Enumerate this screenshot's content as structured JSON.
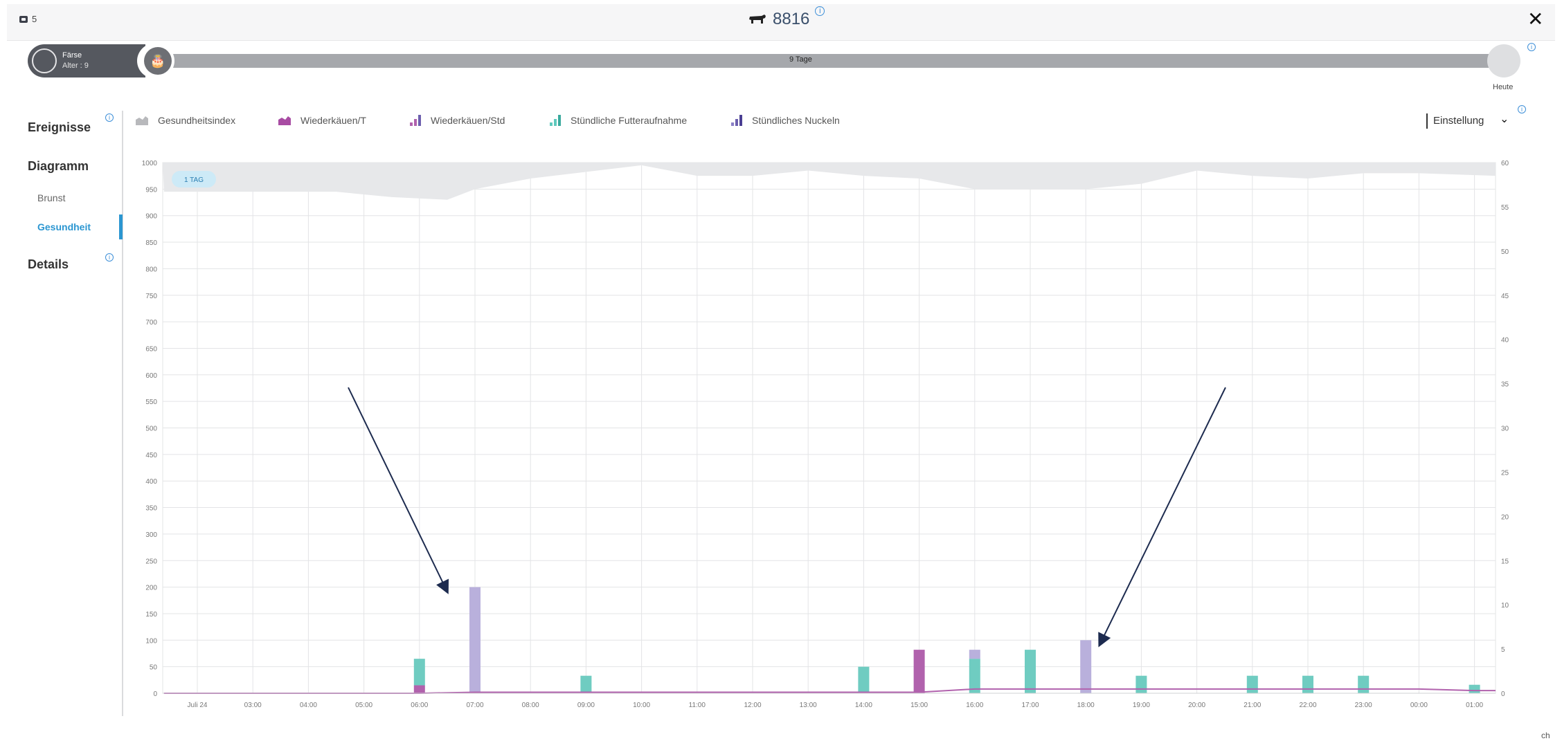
{
  "header": {
    "group_count": "5",
    "animal_id": "8816",
    "close_label": "✕",
    "info_glyph": "i"
  },
  "timeline": {
    "stage_label": "Färse",
    "age_label": "Alter : 9",
    "span_label": "9 Tage",
    "today_label": "Heute",
    "cake_glyph": "🎂"
  },
  "sidebar": {
    "ereignisse": "Ereignisse",
    "diagramm": "Diagramm",
    "brunst": "Brunst",
    "gesundheit": "Gesundheit",
    "details": "Details"
  },
  "legend": {
    "items": [
      {
        "label": "Gesundheitsindex",
        "color": "#c9cacd"
      },
      {
        "label": "Wiederkäuen/T",
        "color": "#b162ad"
      },
      {
        "label": "Wiederkäuen/Std",
        "color": "#b162ad"
      },
      {
        "label": "Stündliche Futteraufnahme",
        "color": "#5fc9bd"
      },
      {
        "label": "Stündliches Nuckeln",
        "color": "#6c5fae"
      }
    ],
    "settings_label": "Einstellung"
  },
  "chart_data": {
    "type": "bar",
    "period_badge": "1 TAG",
    "categories": [
      "Juli 24",
      "03:00",
      "04:00",
      "05:00",
      "06:00",
      "07:00",
      "08:00",
      "09:00",
      "10:00",
      "11:00",
      "12:00",
      "13:00",
      "14:00",
      "15:00",
      "16:00",
      "17:00",
      "18:00",
      "19:00",
      "20:00",
      "21:00",
      "22:00",
      "23:00",
      "00:00",
      "01:00"
    ],
    "y_left": {
      "min": 0,
      "max": 1000,
      "step": 50
    },
    "y_right": {
      "min": 0,
      "max": 60,
      "step": 5
    },
    "grid": true,
    "series": [
      {
        "name": "Gesundheitsindex",
        "kind": "area",
        "axis": "left",
        "x": [
          -0.6,
          0.5,
          2.5,
          3.5,
          4.5,
          5.0,
          6.0,
          8.0,
          9.0,
          10.0,
          11.0,
          12.0,
          13.0,
          14.0,
          15.0,
          16.0,
          17.0,
          18.0,
          19.0,
          20.0,
          21.0,
          22.0,
          23.6
        ],
        "values": [
          945,
          945,
          945,
          935,
          930,
          950,
          970,
          995,
          975,
          975,
          985,
          975,
          970,
          950,
          950,
          950,
          960,
          985,
          975,
          970,
          980,
          980,
          975
        ]
      },
      {
        "name": "Wiederkäuen/T",
        "kind": "line",
        "axis": "left",
        "x": [
          -0.6,
          4.0,
          5.0,
          13.0,
          14.0,
          15.0,
          16.0,
          17.0,
          18.0,
          19.0,
          20.0,
          21.0,
          22.0,
          23.0,
          23.6
        ],
        "values": [
          0,
          0,
          2,
          2,
          8,
          8,
          8,
          8,
          8,
          8,
          8,
          8,
          8,
          5,
          5
        ]
      },
      {
        "name": "Wiederkäuen/Std",
        "kind": "bar",
        "axis": "left",
        "x": [
          4,
          13
        ],
        "values": [
          15,
          82
        ]
      },
      {
        "name": "Stündliche Futteraufnahme",
        "kind": "bar",
        "axis": "left",
        "x": [
          4,
          7,
          12,
          14,
          15,
          17,
          19,
          20,
          21,
          23
        ],
        "values": [
          65,
          33,
          50,
          65,
          82,
          33,
          33,
          33,
          33,
          16
        ]
      },
      {
        "name": "Stündliches Nuckeln",
        "kind": "bar",
        "axis": "left",
        "x": [
          5,
          14,
          16
        ],
        "values": [
          200,
          82,
          100
        ]
      }
    ],
    "annotations": [
      {
        "type": "arrow",
        "target_hour": 5,
        "target_value": 220
      },
      {
        "type": "arrow",
        "target_hour": 16,
        "target_value": 120
      }
    ]
  },
  "footer": {
    "corner_text": "ch"
  }
}
